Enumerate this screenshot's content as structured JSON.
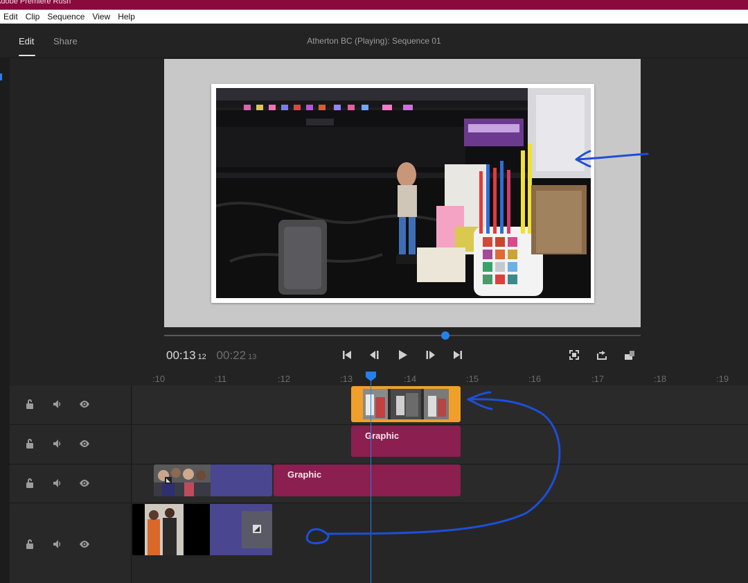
{
  "app": {
    "title": "Adobe Premiere Rush",
    "menu": [
      "Edit",
      "Clip",
      "Sequence",
      "View",
      "Help"
    ]
  },
  "header": {
    "tabs": [
      {
        "label": "Edit",
        "active": true
      },
      {
        "label": "Share",
        "active": false
      }
    ],
    "sequence_title": "Atherton BC (Playing): Sequence 01"
  },
  "playback": {
    "current_time": "00:13",
    "current_frames": "12",
    "duration_time": "00:22",
    "duration_frames": "13",
    "progress_fraction": 0.59,
    "buttons": [
      "go-to-start",
      "step-back",
      "play",
      "step-forward",
      "go-to-end"
    ],
    "right_buttons": [
      "fit-frame",
      "export-frame",
      "aspect-ratio"
    ]
  },
  "timeline": {
    "ruler_ticks": [
      ":10",
      ":11",
      ":12",
      ":13",
      ":14",
      ":15",
      ":16",
      ":17",
      ":18",
      ":19"
    ],
    "tracks": [
      {
        "name": "video-track-3"
      },
      {
        "name": "graphics-track-2"
      },
      {
        "name": "graphics-track-1"
      },
      {
        "name": "video-track-1"
      }
    ],
    "clips": {
      "graphic_upper": "Graphic",
      "graphic_lower": "Graphic"
    }
  },
  "colors": {
    "accent": "#2680eb",
    "titlebar": "#8a0a3c",
    "graphic_clip": "#8b1f4f",
    "video_clip": "#4a4690",
    "selected_clip": "#f0a02a",
    "annotation": "#1d4fd8"
  }
}
